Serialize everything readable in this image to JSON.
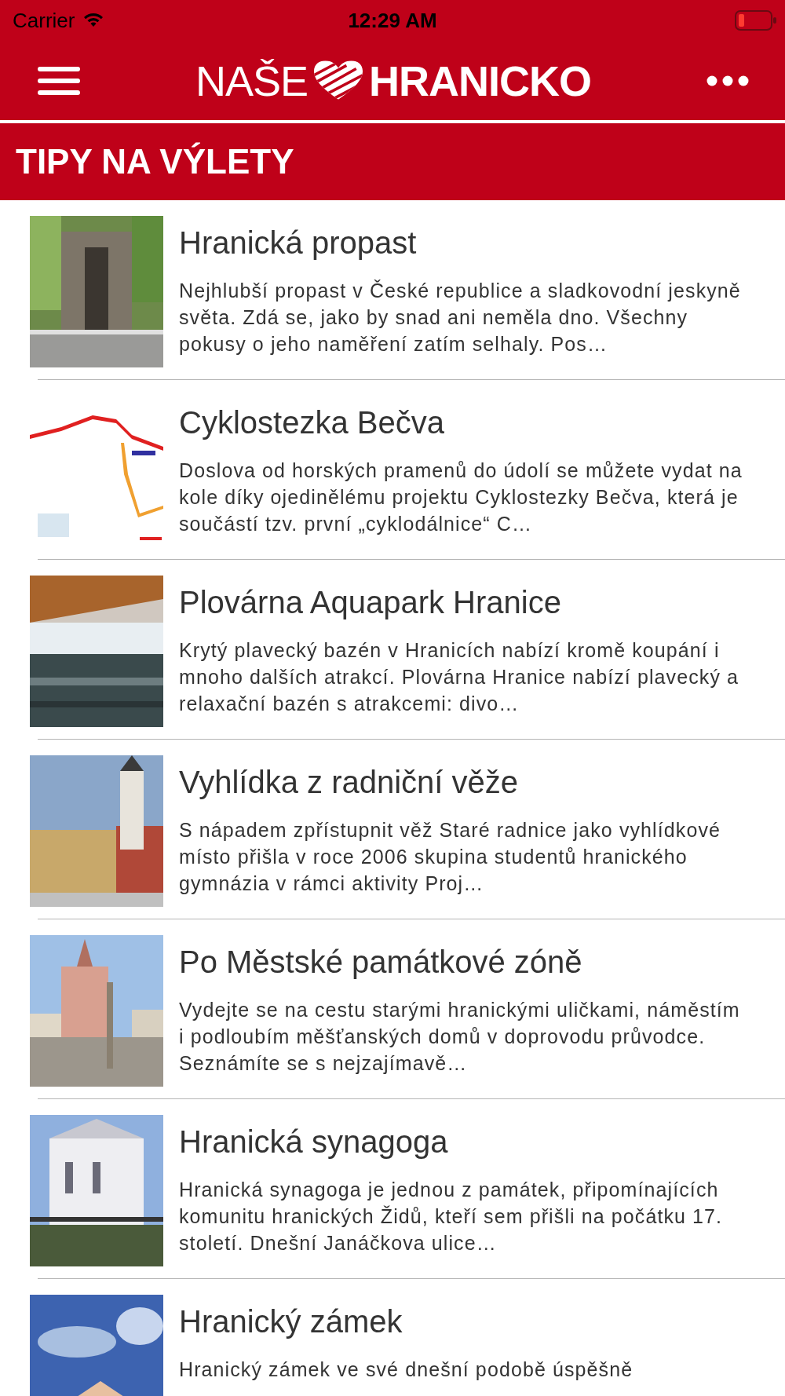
{
  "status_bar": {
    "carrier": "Carrier",
    "time": "12:29 AM"
  },
  "header": {
    "logo_left": "NAŠE",
    "logo_right": "HRANICKO"
  },
  "section_title": "TIPY NA VÝLETY",
  "items": [
    {
      "title": "Hranická propast",
      "description": "Nejhlubší propast v České republice a sladkovodní jeskyně světa. Zdá se, jako by snad ani neměla dno. Všechny pokusy o jeho naměření zatím selhaly. Pos…"
    },
    {
      "title": "Cyklostezka Bečva",
      "description": "Doslova od horských pramenů do údolí se můžete vydat na kole díky ojedinělému projektu Cyklostezky Bečva, která je součástí tzv. první „cyklodálnice“ C…"
    },
    {
      "title": "Plovárna Aquapark Hranice",
      "description": "Krytý plavecký bazén v Hranicích nabízí kromě koupání i mnoho dalších atrakcí. Plovárna Hranice nabízí plavecký a relaxační bazén s atrakcemi: divo…"
    },
    {
      "title": "Vyhlídka z radniční věže",
      "description": "S nápadem zpřístupnit věž Staré radnice jako vyhlídkové místo přišla v roce 2006 skupina studentů hranického gymnázia v rámci aktivity Proj…"
    },
    {
      "title": "Po Městské památkové zóně",
      "description": "Vydejte se na cestu starými hranickými uličkami, náměstím i podloubím měšťanských domů v doprovodu průvodce. Seznámíte se s nejzajímavě…"
    },
    {
      "title": "Hranická synagoga",
      "description": "Hranická synagoga je jednou z památek, připomínajících komunitu hranických Židů, kteří sem přišli na počátku 17. století. Dnešní Janáčkova ulice…"
    },
    {
      "title": "Hranický zámek",
      "description": "Hranický zámek ve své dnešní podobě úspěšně"
    }
  ]
}
